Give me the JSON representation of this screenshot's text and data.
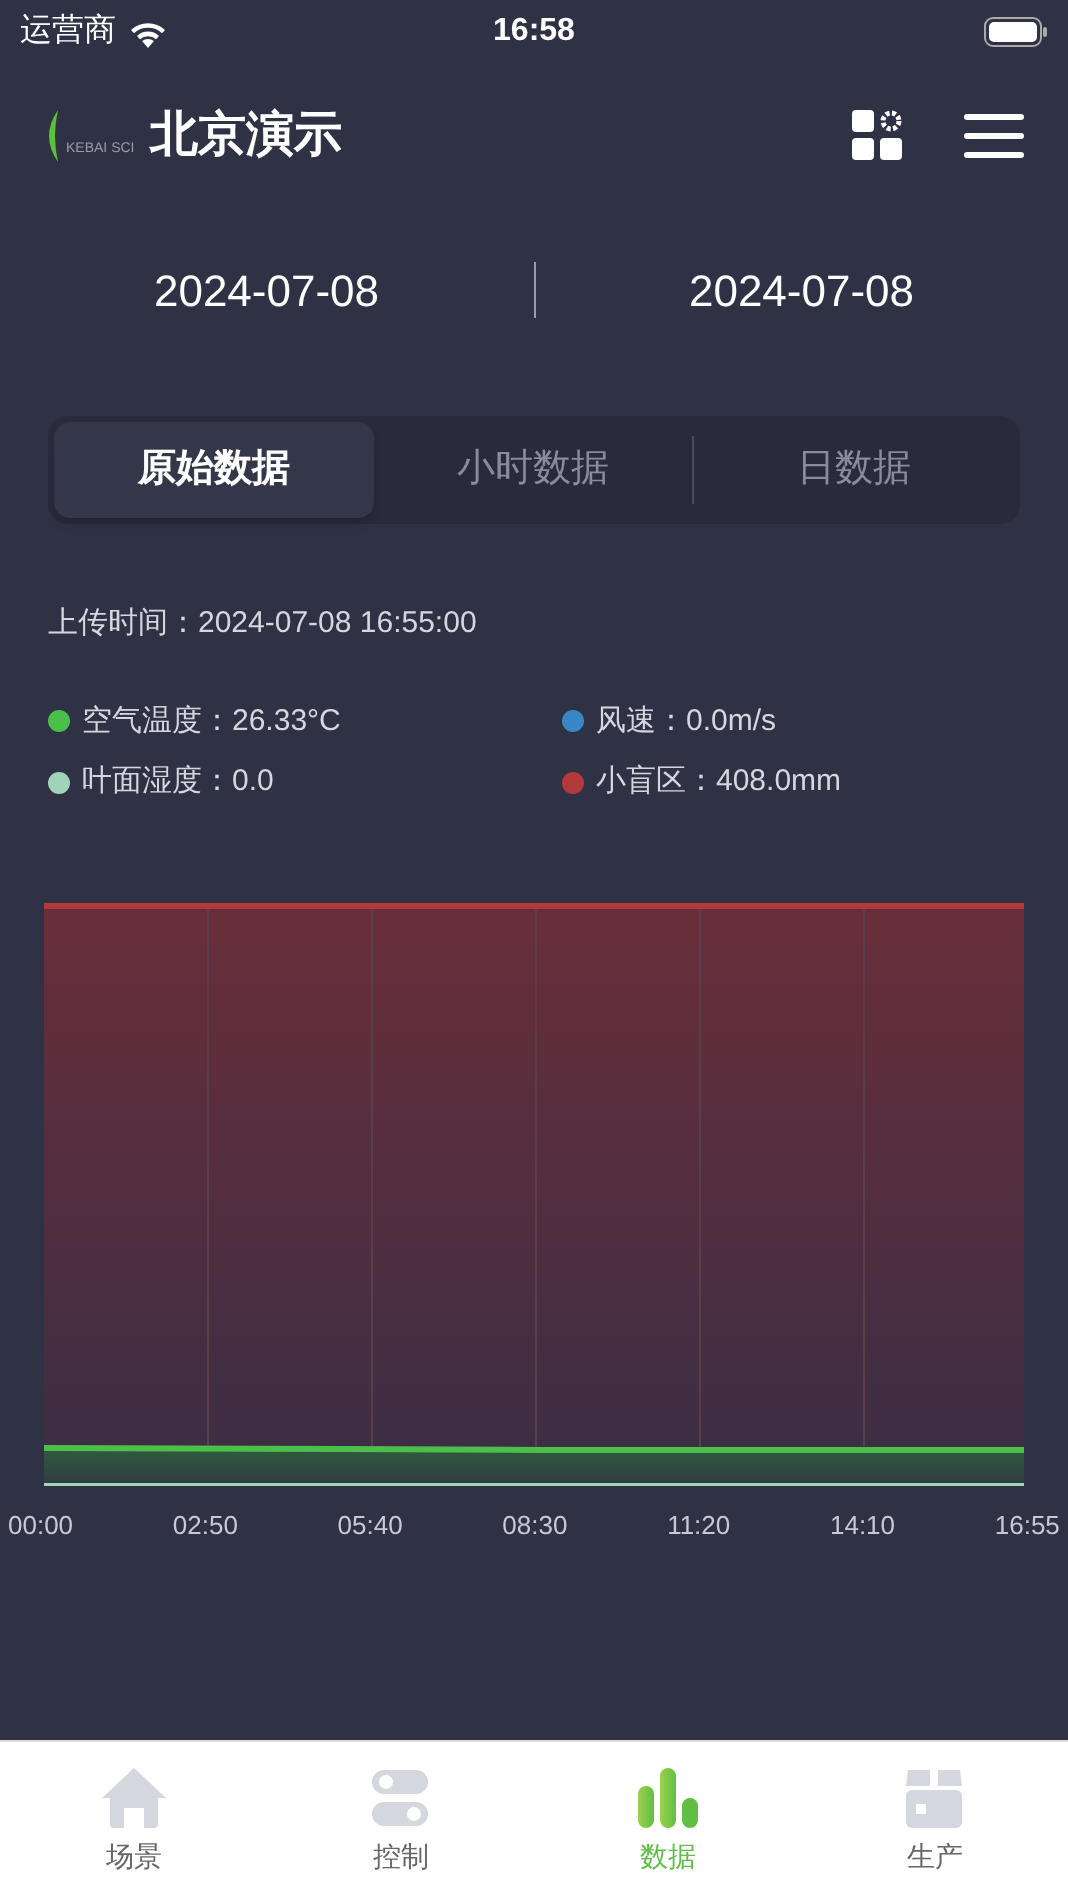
{
  "status_bar": {
    "carrier": "运营商",
    "time": "16:58"
  },
  "header": {
    "logo_text": "KEBAI SCI",
    "title": "北京演示"
  },
  "date_range": {
    "start": "2024-07-08",
    "end": "2024-07-08"
  },
  "segments": [
    {
      "label": "原始数据",
      "selected": true
    },
    {
      "label": "小时数据",
      "selected": false
    },
    {
      "label": "日数据",
      "selected": false
    }
  ],
  "upload_time": "上传时间：2024-07-08 16:55:00",
  "legend": [
    {
      "label": "空气温度：26.33°C",
      "color": "#4cbf4a"
    },
    {
      "label": "风速：0.0m/s",
      "color": "#3a87c8"
    },
    {
      "label": "叶面湿度：0.0",
      "color": "#9fd4b8"
    },
    {
      "label": "小盲区：408.0mm",
      "color": "#b33a3a"
    }
  ],
  "chart": {
    "x_labels": [
      "00:00",
      "02:50",
      "05:40",
      "08:30",
      "11:20",
      "14:10",
      "16:55"
    ]
  },
  "tab_bar": [
    {
      "label": "场景",
      "kind": "home",
      "selected": false
    },
    {
      "label": "控制",
      "kind": "toggles",
      "selected": false
    },
    {
      "label": "数据",
      "kind": "bars",
      "selected": true
    },
    {
      "label": "生产",
      "kind": "box",
      "selected": false
    }
  ]
}
